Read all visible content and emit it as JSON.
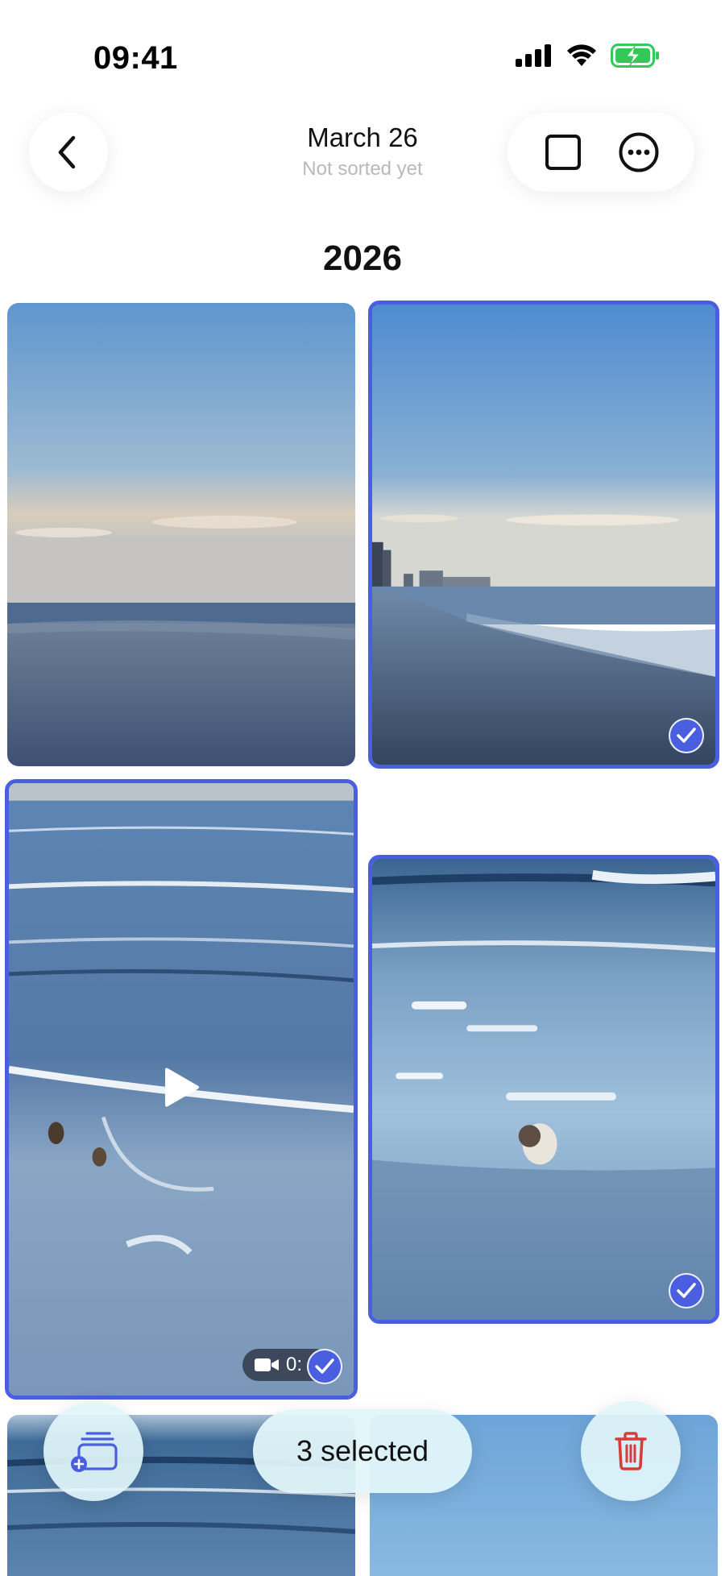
{
  "status_bar": {
    "time": "09:41"
  },
  "nav": {
    "title": "March 26",
    "subtitle": "Not sorted yet"
  },
  "section": {
    "year": "2026"
  },
  "photos": [
    {
      "kind": "photo",
      "selected": false
    },
    {
      "kind": "photo",
      "selected": true
    },
    {
      "kind": "video",
      "selected": true,
      "duration": "0:"
    },
    {
      "kind": "photo",
      "selected": true
    },
    {
      "kind": "photo",
      "selected": false
    },
    {
      "kind": "photo",
      "selected": false
    }
  ],
  "toolbar": {
    "selected_label": "3 selected"
  },
  "colors": {
    "accent": "#4a5fe0",
    "delete": "#d93a3a",
    "battery": "#34c759"
  },
  "icons": [
    "back-chevron-icon",
    "select-square-icon",
    "more-ellipsis-icon",
    "add-to-album-icon",
    "trash-icon",
    "play-icon",
    "video-camera-icon",
    "checkmark-icon"
  ]
}
